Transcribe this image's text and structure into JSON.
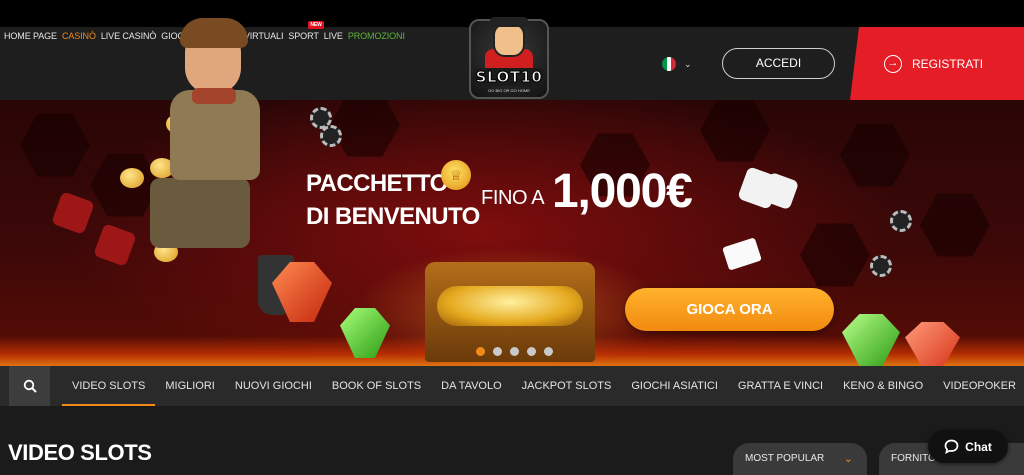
{
  "nav": {
    "items": [
      {
        "label": "HOME PAGE",
        "state": "normal"
      },
      {
        "label": "CASINÒ",
        "state": "active"
      },
      {
        "label": "LIVE CASINÒ",
        "state": "normal"
      },
      {
        "label": "GIOCHI TV",
        "state": "normal"
      },
      {
        "label": "SPORT VIRTUALI",
        "state": "normal"
      },
      {
        "label": "SPORT",
        "state": "normal"
      },
      {
        "label": "LIVE",
        "state": "normal"
      },
      {
        "label": "PROMOZIONI",
        "state": "green"
      }
    ],
    "new_badge": "NEW"
  },
  "logo": {
    "brand": "SLOT10",
    "tagline": "GO BIG OR GO HOME"
  },
  "language": {
    "flag": "italy-flag-icon",
    "colors": [
      "#009246",
      "#ffffff",
      "#ce2b37"
    ]
  },
  "header": {
    "login_label": "ACCEDI",
    "register_label": "REGISTRATI",
    "register_icon": "arrow-circle-icon"
  },
  "hero": {
    "line1": "PACCHETTO",
    "line2": "DI BENVENUTO",
    "prefix": "FINO A",
    "amount": "1,000€",
    "cta": "GIOCA ORA",
    "slides_count": 5,
    "active_slide": 0
  },
  "categories": {
    "search_icon": "search-icon",
    "items": [
      {
        "label": "VIDEO SLOTS",
        "active": true
      },
      {
        "label": "MIGLIORI",
        "active": false
      },
      {
        "label": "NUOVI GIOCHI",
        "active": false
      },
      {
        "label": "BOOK OF SLOTS",
        "active": false
      },
      {
        "label": "DA TAVOLO",
        "active": false
      },
      {
        "label": "JACKPOT SLOTS",
        "active": false
      },
      {
        "label": "GIOCHI ASIATICI",
        "active": false
      },
      {
        "label": "GRATTA E VINCI",
        "active": false
      },
      {
        "label": "KENO & BINGO",
        "active": false
      },
      {
        "label": "VIDEOPOKER",
        "active": false
      }
    ]
  },
  "section": {
    "title": "VIDEO SLOTS",
    "sort_value": "MOST POPULAR",
    "provider_label": "FORNITO"
  },
  "chat": {
    "label": "Chat"
  },
  "colors": {
    "accent": "#f08b1a",
    "register_bg": "#e51d26",
    "promo_green": "#5fb33a",
    "cta": "#f59a18"
  }
}
